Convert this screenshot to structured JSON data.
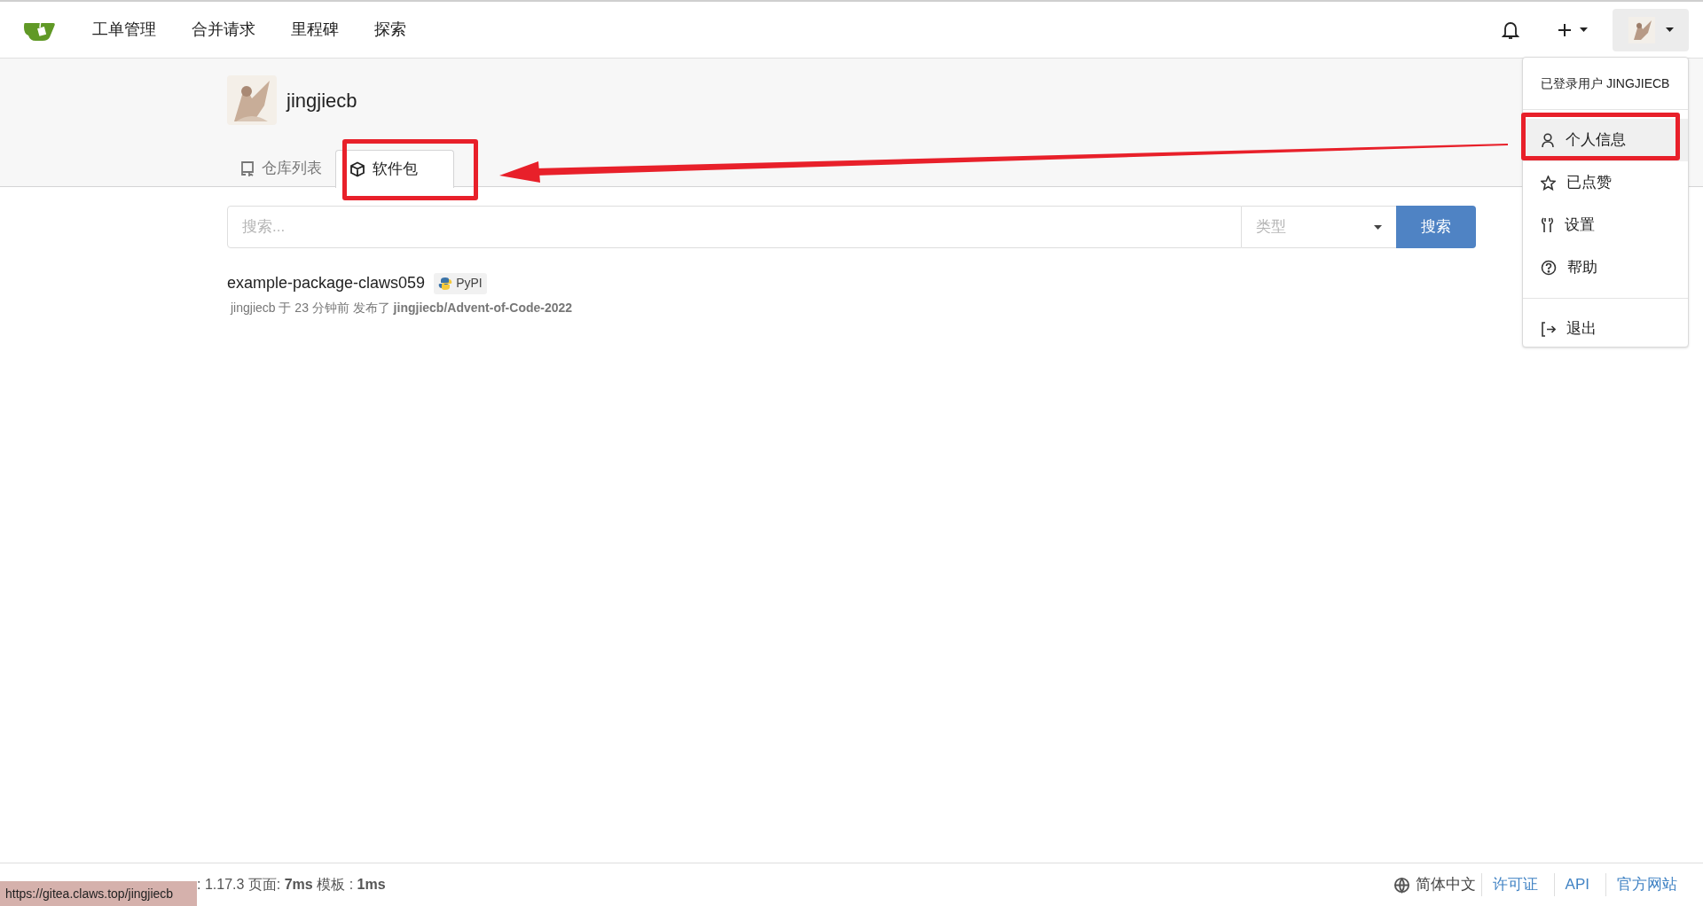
{
  "nav": {
    "items": [
      {
        "label": "工单管理"
      },
      {
        "label": "合并请求"
      },
      {
        "label": "里程碑"
      },
      {
        "label": "探索"
      }
    ]
  },
  "profile": {
    "username": "jingjiecb",
    "tabs": [
      {
        "label": "仓库列表",
        "kind": "repos",
        "selected": false
      },
      {
        "label": "软件包",
        "kind": "packages",
        "selected": true
      }
    ]
  },
  "search": {
    "placeholder": "搜索...",
    "type_placeholder": "类型",
    "button": "搜索"
  },
  "packages": [
    {
      "name": "example-package-claws059",
      "type": "PyPI",
      "meta": "jingjiecb 于 23 分钟前 发布了 **jingjiecb/Advent-of-Code-2022**"
    }
  ],
  "user_menu": {
    "header": "已登录用户 JINGJIECB",
    "items": [
      {
        "label": "个人信息",
        "kind": "person",
        "selected": true
      },
      {
        "label": "已点赞",
        "kind": "star",
        "selected": false
      },
      {
        "label": "设置",
        "kind": "wrench",
        "selected": false
      },
      {
        "label": "帮助",
        "kind": "help",
        "selected": false
      },
      {
        "label": "退出",
        "kind": "logout",
        "selected": false
      }
    ]
  },
  "footer": {
    "version_text": ": 1.17.3 页面: **7ms** 模板 : **1ms**",
    "language": "简体中文",
    "links": [
      "许可证",
      "API",
      "官方网站"
    ]
  },
  "status_url": "https://gitea.claws.top/jingjiecb"
}
